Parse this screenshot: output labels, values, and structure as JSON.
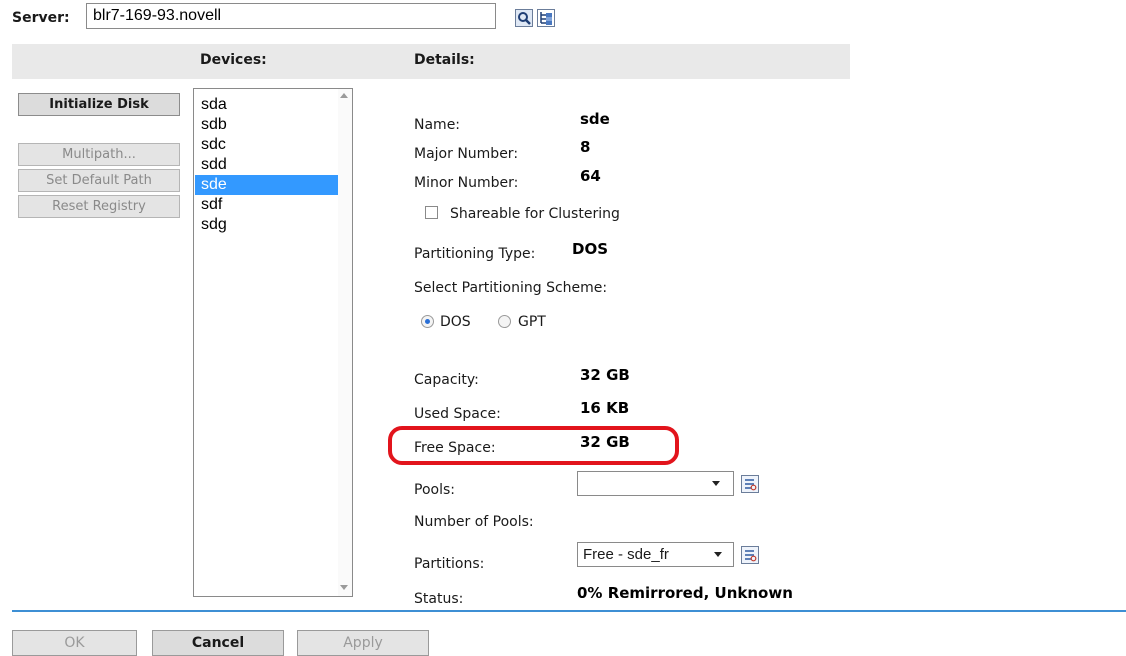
{
  "server": {
    "label": "Server:",
    "value": "blr7-169-93.novell"
  },
  "headers": {
    "devices": "Devices:",
    "details": "Details:"
  },
  "actions": {
    "initialize_disk": "Initialize Disk",
    "multipath": "Multipath...",
    "set_default_path": "Set Default Path",
    "reset_registry": "Reset Registry"
  },
  "devices": [
    "sda",
    "sdb",
    "sdc",
    "sdd",
    "sde",
    "sdf",
    "sdg"
  ],
  "selected_device": "sde",
  "details": {
    "name": {
      "label": "Name:",
      "value": "sde"
    },
    "major_number": {
      "label": "Major Number:",
      "value": "8"
    },
    "minor_number": {
      "label": "Minor Number:",
      "value": "64"
    },
    "shareable": {
      "label": "Shareable for Clustering",
      "checked": false
    },
    "partitioning_type": {
      "label": "Partitioning Type:",
      "value": "DOS"
    },
    "scheme": {
      "label": "Select Partitioning Scheme:",
      "options": [
        "DOS",
        "GPT"
      ],
      "selected": "DOS"
    },
    "capacity": {
      "label": "Capacity:",
      "value": "32 GB"
    },
    "used_space": {
      "label": "Used Space:",
      "value": "16 KB"
    },
    "free_space": {
      "label": "Free Space:",
      "value": "32 GB"
    },
    "pools": {
      "label": "Pools:",
      "value": ""
    },
    "number_of_pools": {
      "label": "Number of Pools:",
      "value": ""
    },
    "partitions": {
      "label": "Partitions:",
      "value": "Free - sde_fr"
    },
    "status": {
      "label": "Status:",
      "value": "0% Remirrored, Unknown"
    }
  },
  "footer": {
    "ok": "OK",
    "cancel": "Cancel",
    "apply": "Apply"
  },
  "colors": {
    "selection": "#3399ff",
    "highlight_ring": "#e2141c",
    "footer_line": "#3d8fd4"
  },
  "icons": [
    "search-icon",
    "browse-tree-icon",
    "list-details-icon"
  ]
}
